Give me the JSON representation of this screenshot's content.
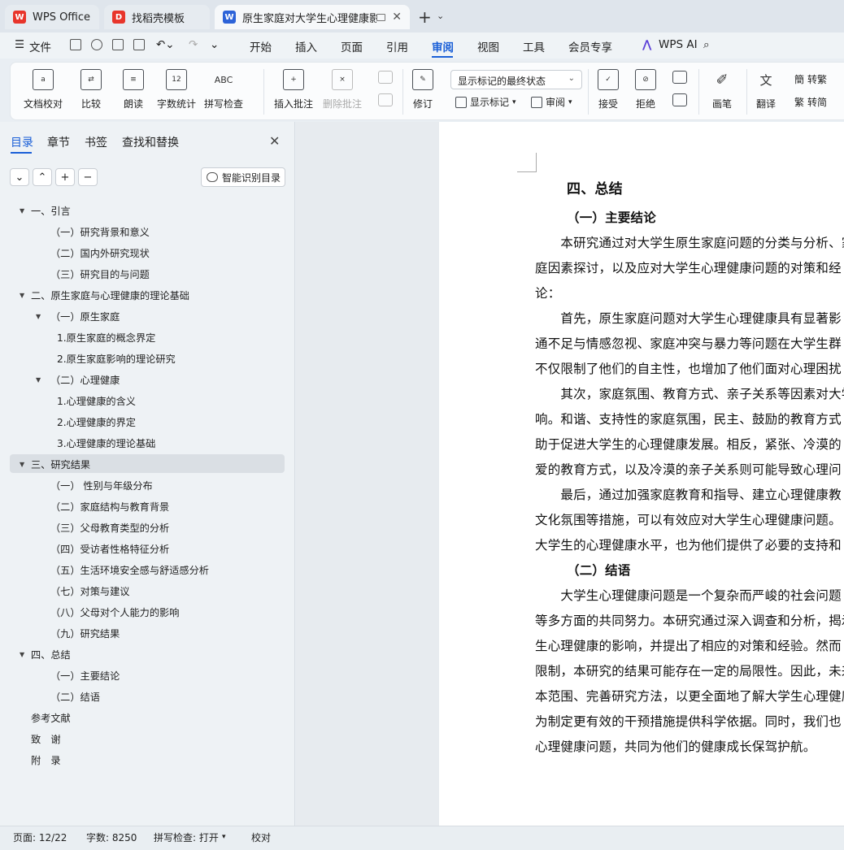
{
  "tabs": [
    {
      "label": "WPS Office",
      "logo": "wps-logo"
    },
    {
      "label": "找稻壳模板",
      "logo": "docer-logo"
    },
    {
      "label": "原生家庭对大学生心理健康影响",
      "logo": "writer-logo"
    }
  ],
  "menu": {
    "file": "文件",
    "items": [
      "开始",
      "插入",
      "页面",
      "引用",
      "审阅",
      "视图",
      "工具",
      "会员专享"
    ],
    "active": "审阅",
    "wps_ai": "WPS AI"
  },
  "ribbon": {
    "doc_proof": "文档校对",
    "compare": "比较",
    "read_aloud": "朗读",
    "word_count": "字数统计",
    "spell_check": "拼写检查",
    "insert_comment": "插入批注",
    "delete_comment": "删除批注",
    "revise": "修订",
    "markup_select": "显示标记的最终状态",
    "show_markup": "显示标记",
    "review": "审阅",
    "accept": "接受",
    "reject": "拒绝",
    "pen": "画笔",
    "translate": "翻译",
    "to_traditional": "转繁",
    "to_simplified": "转简",
    "icon_texts": {
      "word_count": "12",
      "spell": "ABC"
    }
  },
  "panel": {
    "tabs": [
      "目录",
      "章节",
      "书签",
      "查找和替换"
    ],
    "active_tab": "目录",
    "smart_toc": "智能识别目录",
    "toc": [
      {
        "text": "一、引言",
        "level": 0,
        "expanded": true
      },
      {
        "text": "（一）研究背景和意义",
        "level": 1
      },
      {
        "text": "（二）国内外研究现状",
        "level": 1
      },
      {
        "text": "（三）研究目的与问题",
        "level": 1
      },
      {
        "text": "二、原生家庭与心理健康的理论基础",
        "level": 0,
        "expanded": true
      },
      {
        "text": "（一）原生家庭",
        "level": 1,
        "expanded": true
      },
      {
        "text": "1.原生家庭的概念界定",
        "level": 2
      },
      {
        "text": "2.原生家庭影响的理论研究",
        "level": 2
      },
      {
        "text": "（二）心理健康",
        "level": 1,
        "expanded": true
      },
      {
        "text": "1.心理健康的含义",
        "level": 2
      },
      {
        "text": "2.心理健康的界定",
        "level": 2
      },
      {
        "text": "3.心理健康的理论基础",
        "level": 2
      },
      {
        "text": "三、研究结果",
        "level": 0,
        "expanded": true,
        "selected": true
      },
      {
        "text": "（一）  性别与年级分布",
        "level": 1
      },
      {
        "text": "（二）家庭结构与教育背景",
        "level": 1
      },
      {
        "text": "（三）父母教育类型的分析",
        "level": 1
      },
      {
        "text": "（四）受访者性格特征分析",
        "level": 1
      },
      {
        "text": "（五）生活环境安全感与舒适感分析",
        "level": 1
      },
      {
        "text": "（七）对策与建议",
        "level": 1
      },
      {
        "text": "（八）父母对个人能力的影响",
        "level": 1
      },
      {
        "text": "（九）研究结果",
        "level": 1
      },
      {
        "text": "四、总结",
        "level": 0,
        "expanded": true
      },
      {
        "text": "（一）主要结论",
        "level": 1
      },
      {
        "text": "（二）结语",
        "level": 1
      },
      {
        "text": "参考文献",
        "level": 0
      },
      {
        "text": "致　谢",
        "level": 0
      },
      {
        "text": "附　录",
        "level": 0
      }
    ]
  },
  "document": {
    "lines": [
      {
        "text": "四、总结",
        "style": "h1"
      },
      {
        "text": "（一）主要结论",
        "style": "h2"
      },
      {
        "text": "　　本研究通过对大学生原生家庭问题的分类与分析、家",
        "style": "p"
      },
      {
        "text": "庭因素探讨，以及应对大学生心理健康问题的对策和经",
        "style": "p"
      },
      {
        "text": "论：",
        "style": "p"
      },
      {
        "text": "　　首先，原生家庭问题对大学生心理健康具有显著影",
        "style": "p"
      },
      {
        "text": "通不足与情感忽视、家庭冲突与暴力等问题在大学生群",
        "style": "p"
      },
      {
        "text": "不仅限制了他们的自主性，也增加了他们面对心理困扰",
        "style": "p"
      },
      {
        "text": "　　其次，家庭氛围、教育方式、亲子关系等因素对大学",
        "style": "p"
      },
      {
        "text": "响。和谐、支持性的家庭氛围，民主、鼓励的教育方式",
        "style": "p"
      },
      {
        "text": "助于促进大学生的心理健康发展。相反，紧张、冷漠的",
        "style": "p"
      },
      {
        "text": "爱的教育方式，以及冷漠的亲子关系则可能导致心理问",
        "style": "p"
      },
      {
        "text": "　　最后，通过加强家庭教育和指导、建立心理健康教",
        "style": "p"
      },
      {
        "text": "文化氛围等措施，可以有效应对大学生心理健康问题。",
        "style": "p"
      },
      {
        "text": "大学生的心理健康水平，也为他们提供了必要的支持和",
        "style": "p"
      },
      {
        "text": "（二）结语",
        "style": "h2"
      },
      {
        "text": "　　大学生心理健康问题是一个复杂而严峻的社会问题",
        "style": "p"
      },
      {
        "text": "等多方面的共同努力。本研究通过深入调查和分析，揭示",
        "style": "p"
      },
      {
        "text": "生心理健康的影响，并提出了相应的对策和经验。然而",
        "style": "p"
      },
      {
        "text": "限制，本研究的结果可能存在一定的局限性。因此，未来",
        "style": "p"
      },
      {
        "text": "本范围、完善研究方法，以更全面地了解大学生心理健康",
        "style": "p"
      },
      {
        "text": "为制定更有效的干预措施提供科学依据。同时，我们也",
        "style": "p"
      },
      {
        "text": "心理健康问题，共同为他们的健康成长保驾护航。",
        "style": "p"
      }
    ]
  },
  "status": {
    "page": "页面: 12/22",
    "words": "字数: 8250",
    "spell": "拼写检查: 打开",
    "proof": "校对"
  },
  "colors": {
    "accent": "#1a5fd7",
    "wps_red": "#e8352b",
    "writer_blue": "#2d63d8"
  }
}
